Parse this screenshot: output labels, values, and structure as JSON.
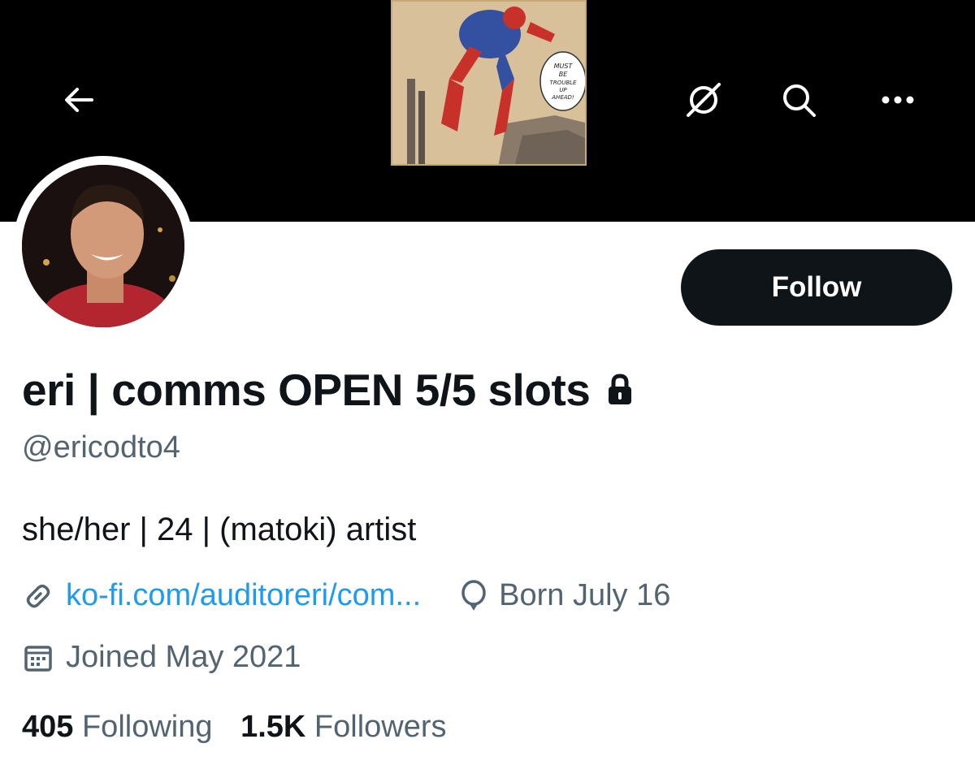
{
  "header": {
    "back_icon": "arrow-left-icon",
    "icons": [
      "no-connection-icon",
      "search-icon",
      "more-icon"
    ],
    "banner_art_caption": "MUST BE TROUBLE UP AHEAD!"
  },
  "profile": {
    "follow_label": "Follow",
    "display_name": "eri | comms OPEN 5/5 slots",
    "protected_icon": "lock-icon",
    "handle": "@ericodto4",
    "bio": "she/her | 24 | (matoki) artist",
    "website": "ko-fi.com/auditoreri/com...",
    "birthday": "Born July 16",
    "joined": "Joined May 2021"
  },
  "stats": {
    "following_count": "405",
    "following_label": "Following",
    "followers_count": "1.5K",
    "followers_label": "Followers"
  },
  "colors": {
    "banner": "#000000",
    "text": "#0f1419",
    "secondary": "#536471",
    "link": "#1d9bf0",
    "button": "#0f1419"
  }
}
